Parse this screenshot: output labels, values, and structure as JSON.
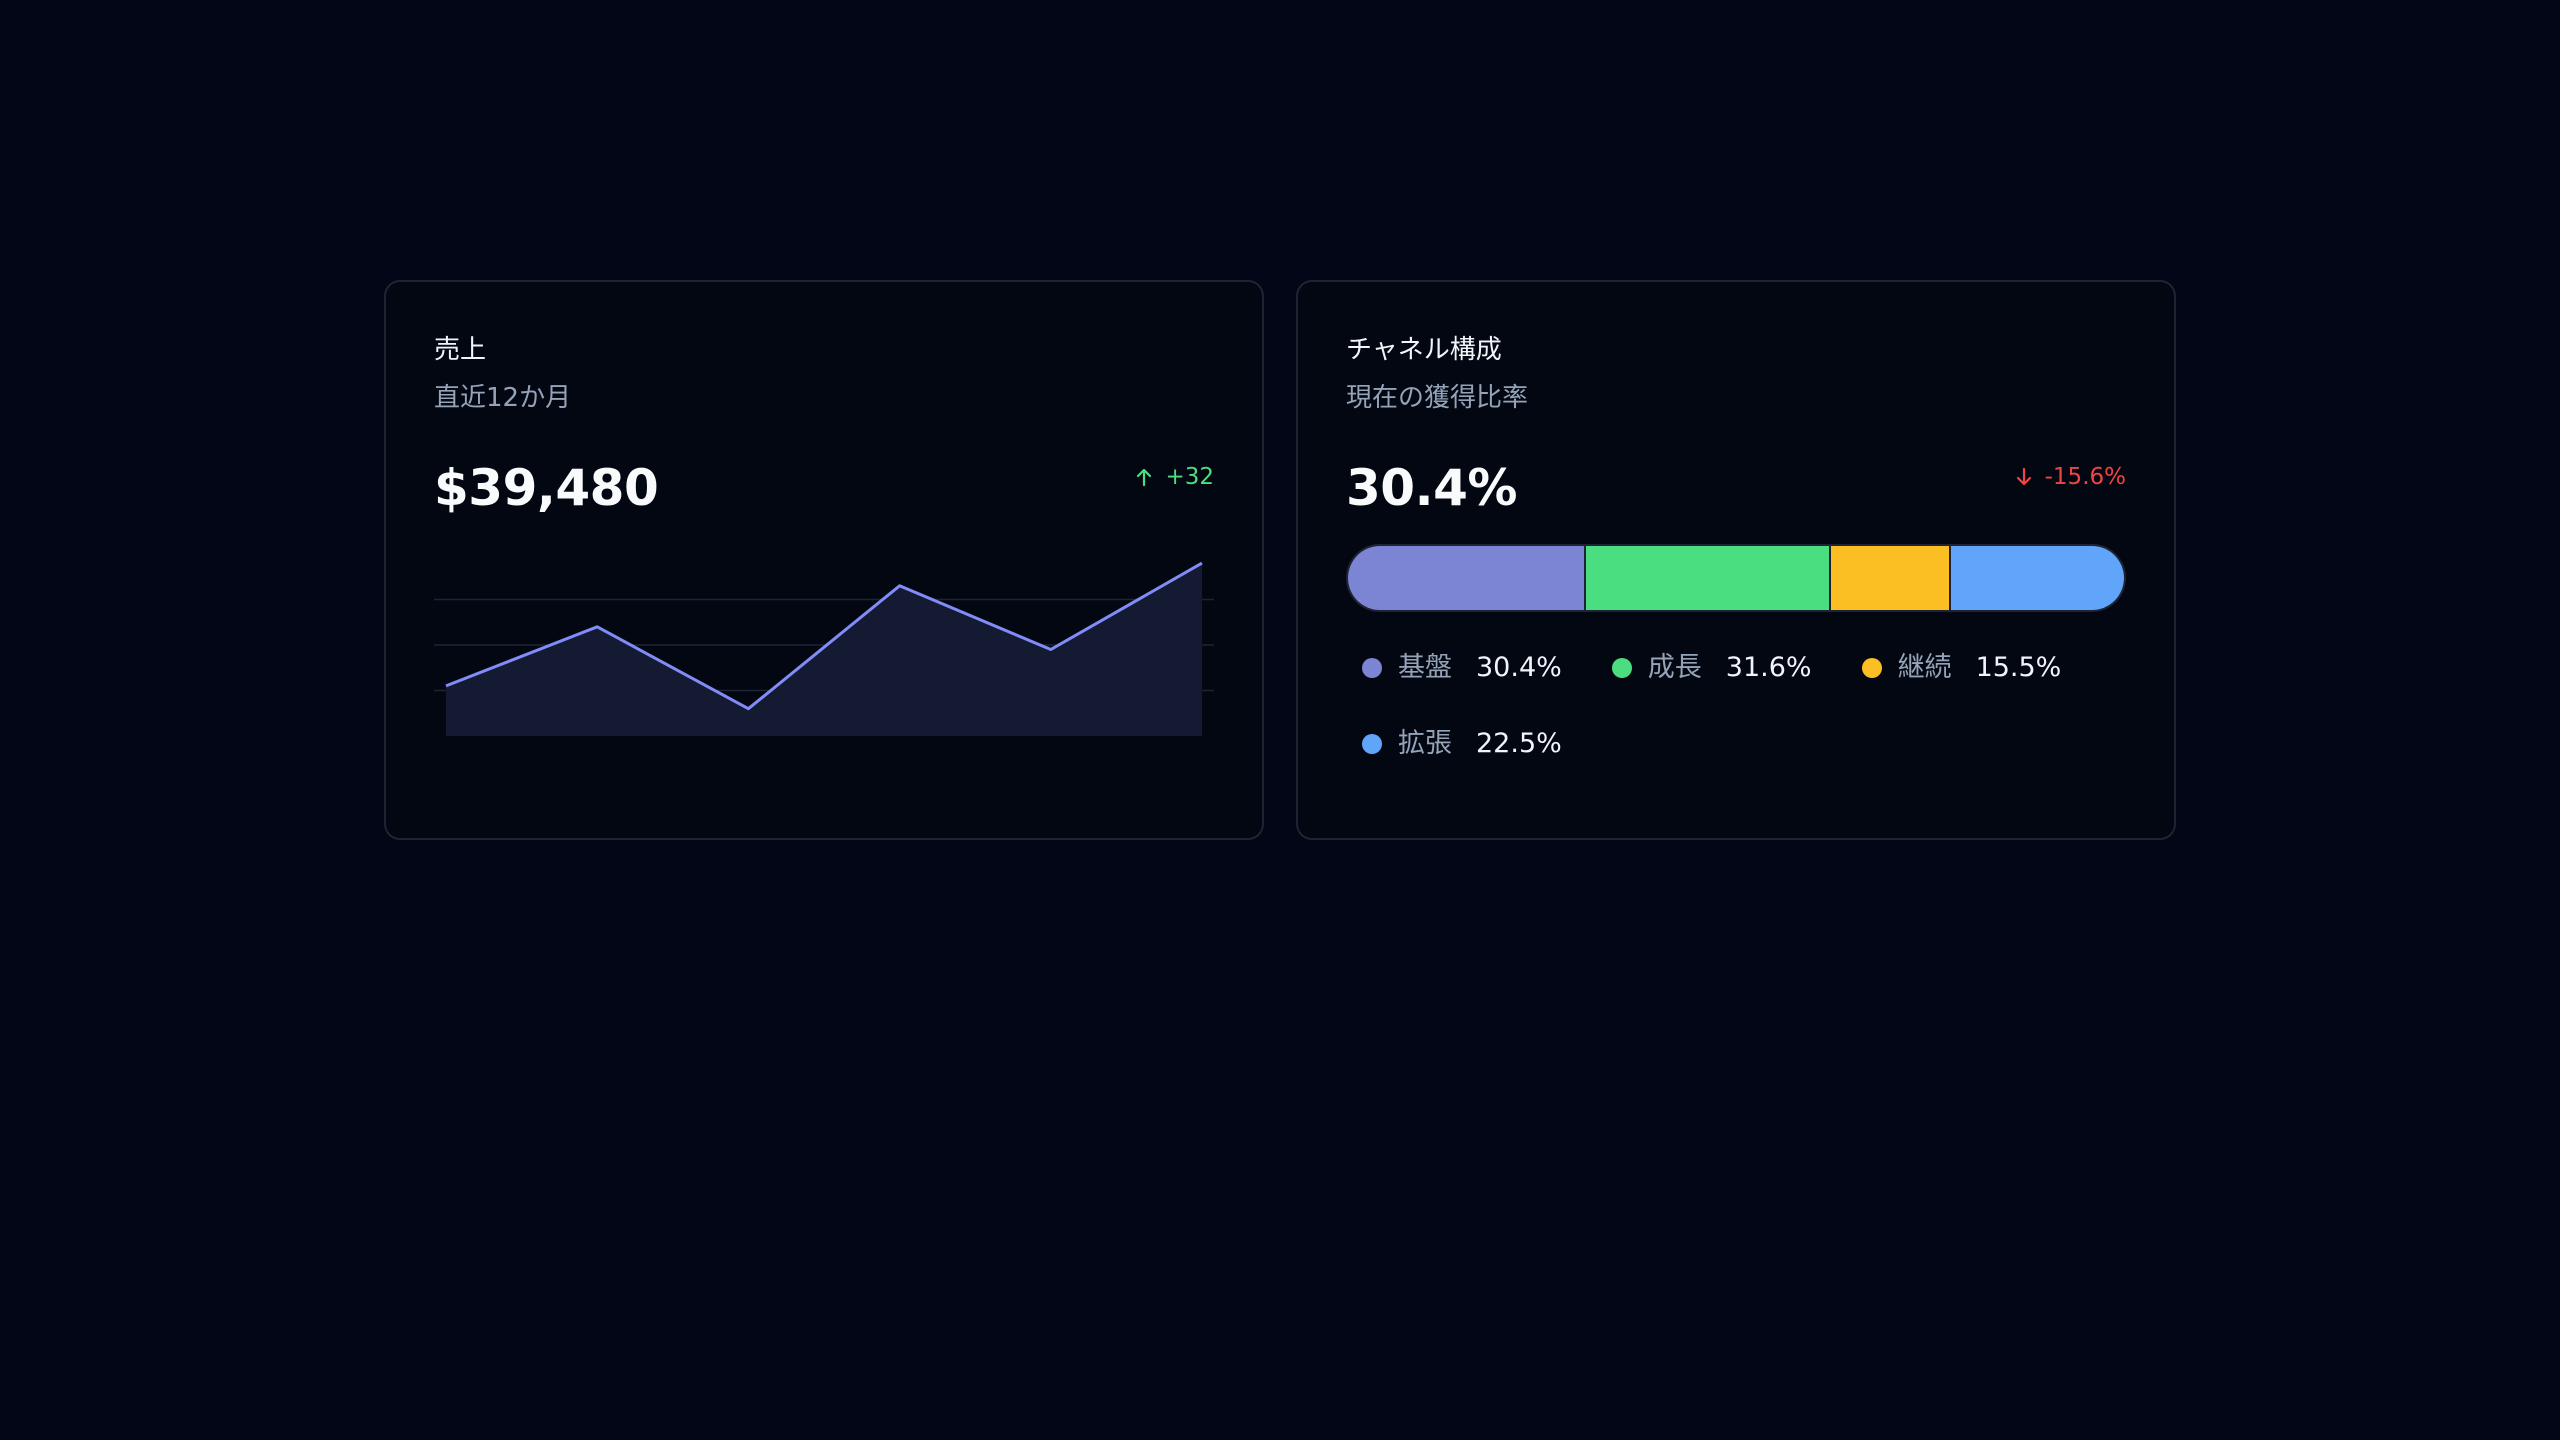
{
  "cards": {
    "sales": {
      "title": "売上",
      "subtitle": "直近12か月",
      "value": "$39,480",
      "delta": "+32",
      "delta_direction": "up",
      "arrow_icon": "arrow-up-icon",
      "chart_data": {
        "type": "area",
        "x": [
          1,
          2,
          3,
          4,
          5,
          6
        ],
        "values": [
          42,
          68,
          32,
          86,
          58,
          96
        ],
        "ylim": [
          20,
          100
        ],
        "grid": true,
        "line_color": "#818cf8",
        "fill_color": "#151a33"
      }
    },
    "channel": {
      "title": "チャネル構成",
      "subtitle": "現在の獲得比率",
      "value": "30.4%",
      "delta": "-15.6%",
      "delta_direction": "down",
      "arrow_icon": "arrow-down-icon",
      "segments": [
        {
          "label": "基盤",
          "value": "30.4%",
          "pct": 30.4,
          "color": "#7c85d4"
        },
        {
          "label": "成長",
          "value": "31.6%",
          "pct": 31.6,
          "color": "#4ade80"
        },
        {
          "label": "継続",
          "value": "15.5%",
          "pct": 15.5,
          "color": "#fbbf24"
        },
        {
          "label": "拡張",
          "value": "22.5%",
          "pct": 22.5,
          "color": "#60a5fa"
        }
      ]
    }
  },
  "colors": {
    "background": "#020617",
    "card_border": "#1e2433",
    "positive": "#4ade80",
    "negative": "#ef4444"
  }
}
